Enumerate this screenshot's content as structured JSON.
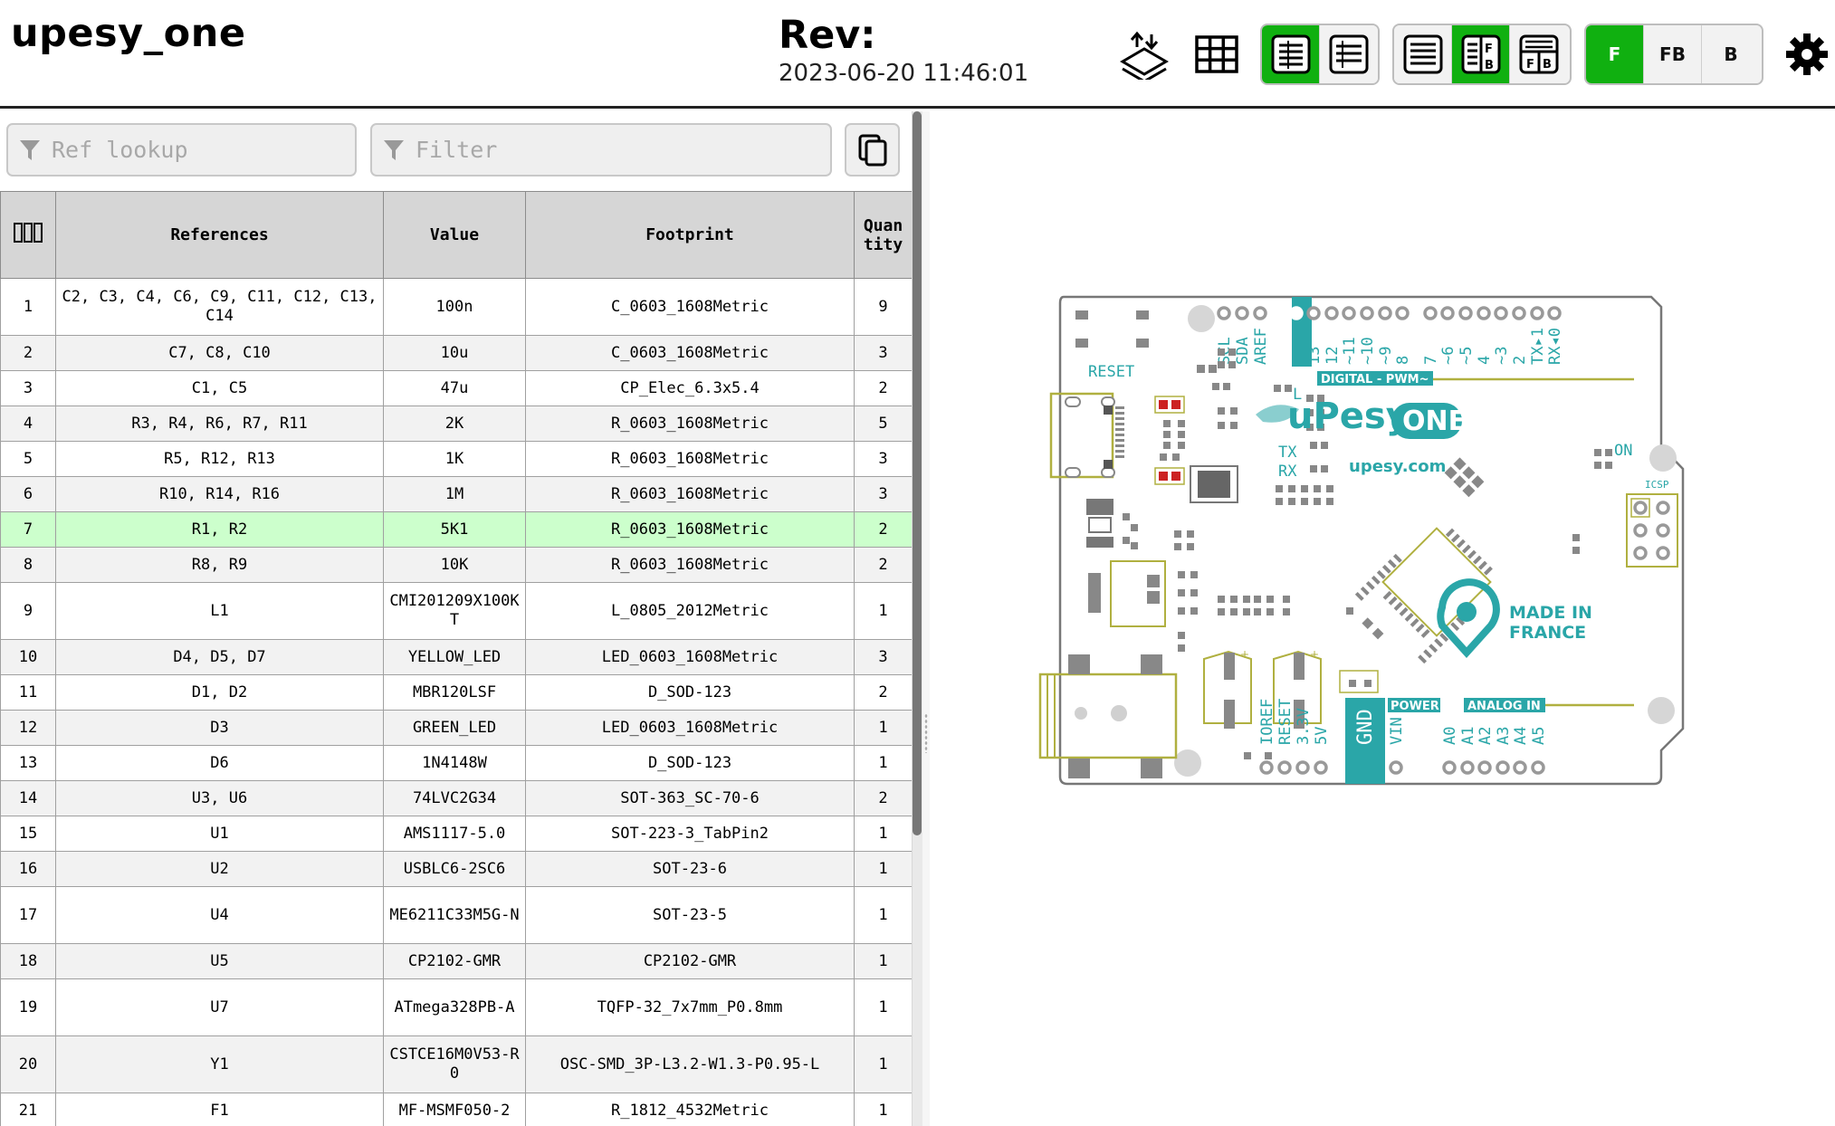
{
  "header": {
    "title": "upesy_one",
    "rev_label": "Rev:",
    "rev_date": "2023-06-20 11:46:01"
  },
  "toolbar": {
    "icons": [
      "pcb-layers-icon",
      "grid-icon"
    ],
    "list_mode_group": [
      {
        "name": "bom-netlist-icon",
        "active": true
      },
      {
        "name": "bom-list-icon",
        "active": false
      }
    ],
    "layout_group": [
      {
        "name": "layout-bom-only-icon",
        "active": false
      },
      {
        "name": "layout-bom-left-icon",
        "active": true
      },
      {
        "name": "layout-bom-top-icon",
        "active": false
      }
    ],
    "layer_group": [
      {
        "label": "F",
        "active": true
      },
      {
        "label": "FB",
        "active": false
      },
      {
        "label": "B",
        "active": false
      }
    ],
    "settings_icon": "gear-icon"
  },
  "filters": {
    "ref_lookup_placeholder": "Ref lookup",
    "filter_placeholder": "Filter"
  },
  "table": {
    "columns": [
      "",
      "References",
      "Value",
      "Footprint",
      "Quan tity"
    ],
    "rows": [
      {
        "n": "1",
        "refs": "C2, C3, C4, C6, C9, C11, C12, C13, C14",
        "value": "100n",
        "footprint": "C_0603_1608Metric",
        "qty": "9"
      },
      {
        "n": "2",
        "refs": "C7, C8, C10",
        "value": "10u",
        "footprint": "C_0603_1608Metric",
        "qty": "3"
      },
      {
        "n": "3",
        "refs": "C1, C5",
        "value": "47u",
        "footprint": "CP_Elec_6.3x5.4",
        "qty": "2"
      },
      {
        "n": "4",
        "refs": "R3, R4, R6, R7, R11",
        "value": "2K",
        "footprint": "R_0603_1608Metric",
        "qty": "5"
      },
      {
        "n": "5",
        "refs": "R5, R12, R13",
        "value": "1K",
        "footprint": "R_0603_1608Metric",
        "qty": "3"
      },
      {
        "n": "6",
        "refs": "R10, R14, R16",
        "value": "1M",
        "footprint": "R_0603_1608Metric",
        "qty": "3"
      },
      {
        "n": "7",
        "refs": "R1, R2",
        "value": "5K1",
        "footprint": "R_0603_1608Metric",
        "qty": "2"
      },
      {
        "n": "8",
        "refs": "R8, R9",
        "value": "10K",
        "footprint": "R_0603_1608Metric",
        "qty": "2"
      },
      {
        "n": "9",
        "refs": "L1",
        "value": "CMI201209X100KT",
        "footprint": "L_0805_2012Metric",
        "qty": "1"
      },
      {
        "n": "10",
        "refs": "D4, D5, D7",
        "value": "YELLOW_LED",
        "footprint": "LED_0603_1608Metric",
        "qty": "3"
      },
      {
        "n": "11",
        "refs": "D1, D2",
        "value": "MBR120LSF",
        "footprint": "D_SOD-123",
        "qty": "2"
      },
      {
        "n": "12",
        "refs": "D3",
        "value": "GREEN_LED",
        "footprint": "LED_0603_1608Metric",
        "qty": "1"
      },
      {
        "n": "13",
        "refs": "D6",
        "value": "1N4148W",
        "footprint": "D_SOD-123",
        "qty": "1"
      },
      {
        "n": "14",
        "refs": "U3, U6",
        "value": "74LVC2G34",
        "footprint": "SOT-363_SC-70-6",
        "qty": "2"
      },
      {
        "n": "15",
        "refs": "U1",
        "value": "AMS1117-5.0",
        "footprint": "SOT-223-3_TabPin2",
        "qty": "1"
      },
      {
        "n": "16",
        "refs": "U2",
        "value": "USBLC6-2SC6",
        "footprint": "SOT-23-6",
        "qty": "1"
      },
      {
        "n": "17",
        "refs": "U4",
        "value": "ME6211C33M5G-N",
        "footprint": "SOT-23-5",
        "qty": "1"
      },
      {
        "n": "18",
        "refs": "U5",
        "value": "CP2102-GMR",
        "footprint": "CP2102-GMR",
        "qty": "1"
      },
      {
        "n": "19",
        "refs": "U7",
        "value": "ATmega328PB-A",
        "footprint": "TQFP-32_7x7mm_P0.8mm",
        "qty": "1"
      },
      {
        "n": "20",
        "refs": "Y1",
        "value": "CSTCE16M0V53-R0",
        "footprint": "OSC-SMD_3P-L3.2-W1.3-P0.95-L",
        "qty": "1"
      },
      {
        "n": "21",
        "refs": "F1",
        "value": "MF-MSMF050-2",
        "footprint": "R_1812_4532Metric",
        "qty": "1"
      }
    ],
    "highlighted_row": "7"
  },
  "board": {
    "header_labels": [
      "SCL",
      "SDA",
      "AREF",
      "GND",
      "13",
      "12",
      "~11",
      "~10",
      "~9",
      "8",
      "7",
      "~6",
      "~5",
      "4",
      "~3",
      "2",
      "TX▸1",
      "RX◂0"
    ],
    "reset_label": "RESET",
    "digital_label": "DIGITAL - PWM~",
    "logo_text": "uPesy",
    "logo_badge": "ONE",
    "website": "upesy.com",
    "led_labels": [
      "L",
      "TX",
      "RX",
      "ON"
    ],
    "icsp_label": "ICSP",
    "made_in": "MADE IN",
    "country": "FRANCE",
    "power_label": "POWER",
    "analog_label": "ANALOG IN",
    "power_pins": [
      "IOREF",
      "RESET",
      "3.3V",
      "5V",
      "GND",
      "VIN"
    ],
    "analog_pins": [
      "A0",
      "A1",
      "A2",
      "A3",
      "A4",
      "A5"
    ],
    "colors": {
      "teal": "#2aa6a8",
      "outline": "#b0b040",
      "pad": "#bdbdbd",
      "dark": "#606060",
      "red": "#cc2222"
    }
  }
}
